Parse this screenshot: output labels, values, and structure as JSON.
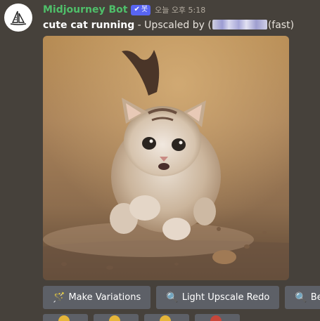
{
  "message": {
    "author": "Midjourney Bot",
    "bot_tag": "봇",
    "timestamp": "오늘 오후 5:18",
    "prompt": "cute cat running",
    "content_middle": " - Upscaled by ",
    "content_end": "(fast)"
  },
  "image": {
    "alt_icon": "generated-image"
  },
  "buttons": [
    {
      "label": "Make Variations",
      "icon": "magic-wand-icon"
    },
    {
      "label": "Light Upscale Redo",
      "icon": "magnifier-icon"
    },
    {
      "label": "Be",
      "icon": "magnifier-icon"
    }
  ],
  "reactions": [
    {
      "icon": "emoji-face-icon"
    },
    {
      "icon": "emoji-face-icon"
    },
    {
      "icon": "emoji-face-icon"
    },
    {
      "icon": "emoji-red-icon"
    }
  ],
  "colors": {
    "background": "#46413b",
    "author": "#4fbf6a",
    "bot_tag": "#5865f2",
    "button": "#5d6067"
  }
}
